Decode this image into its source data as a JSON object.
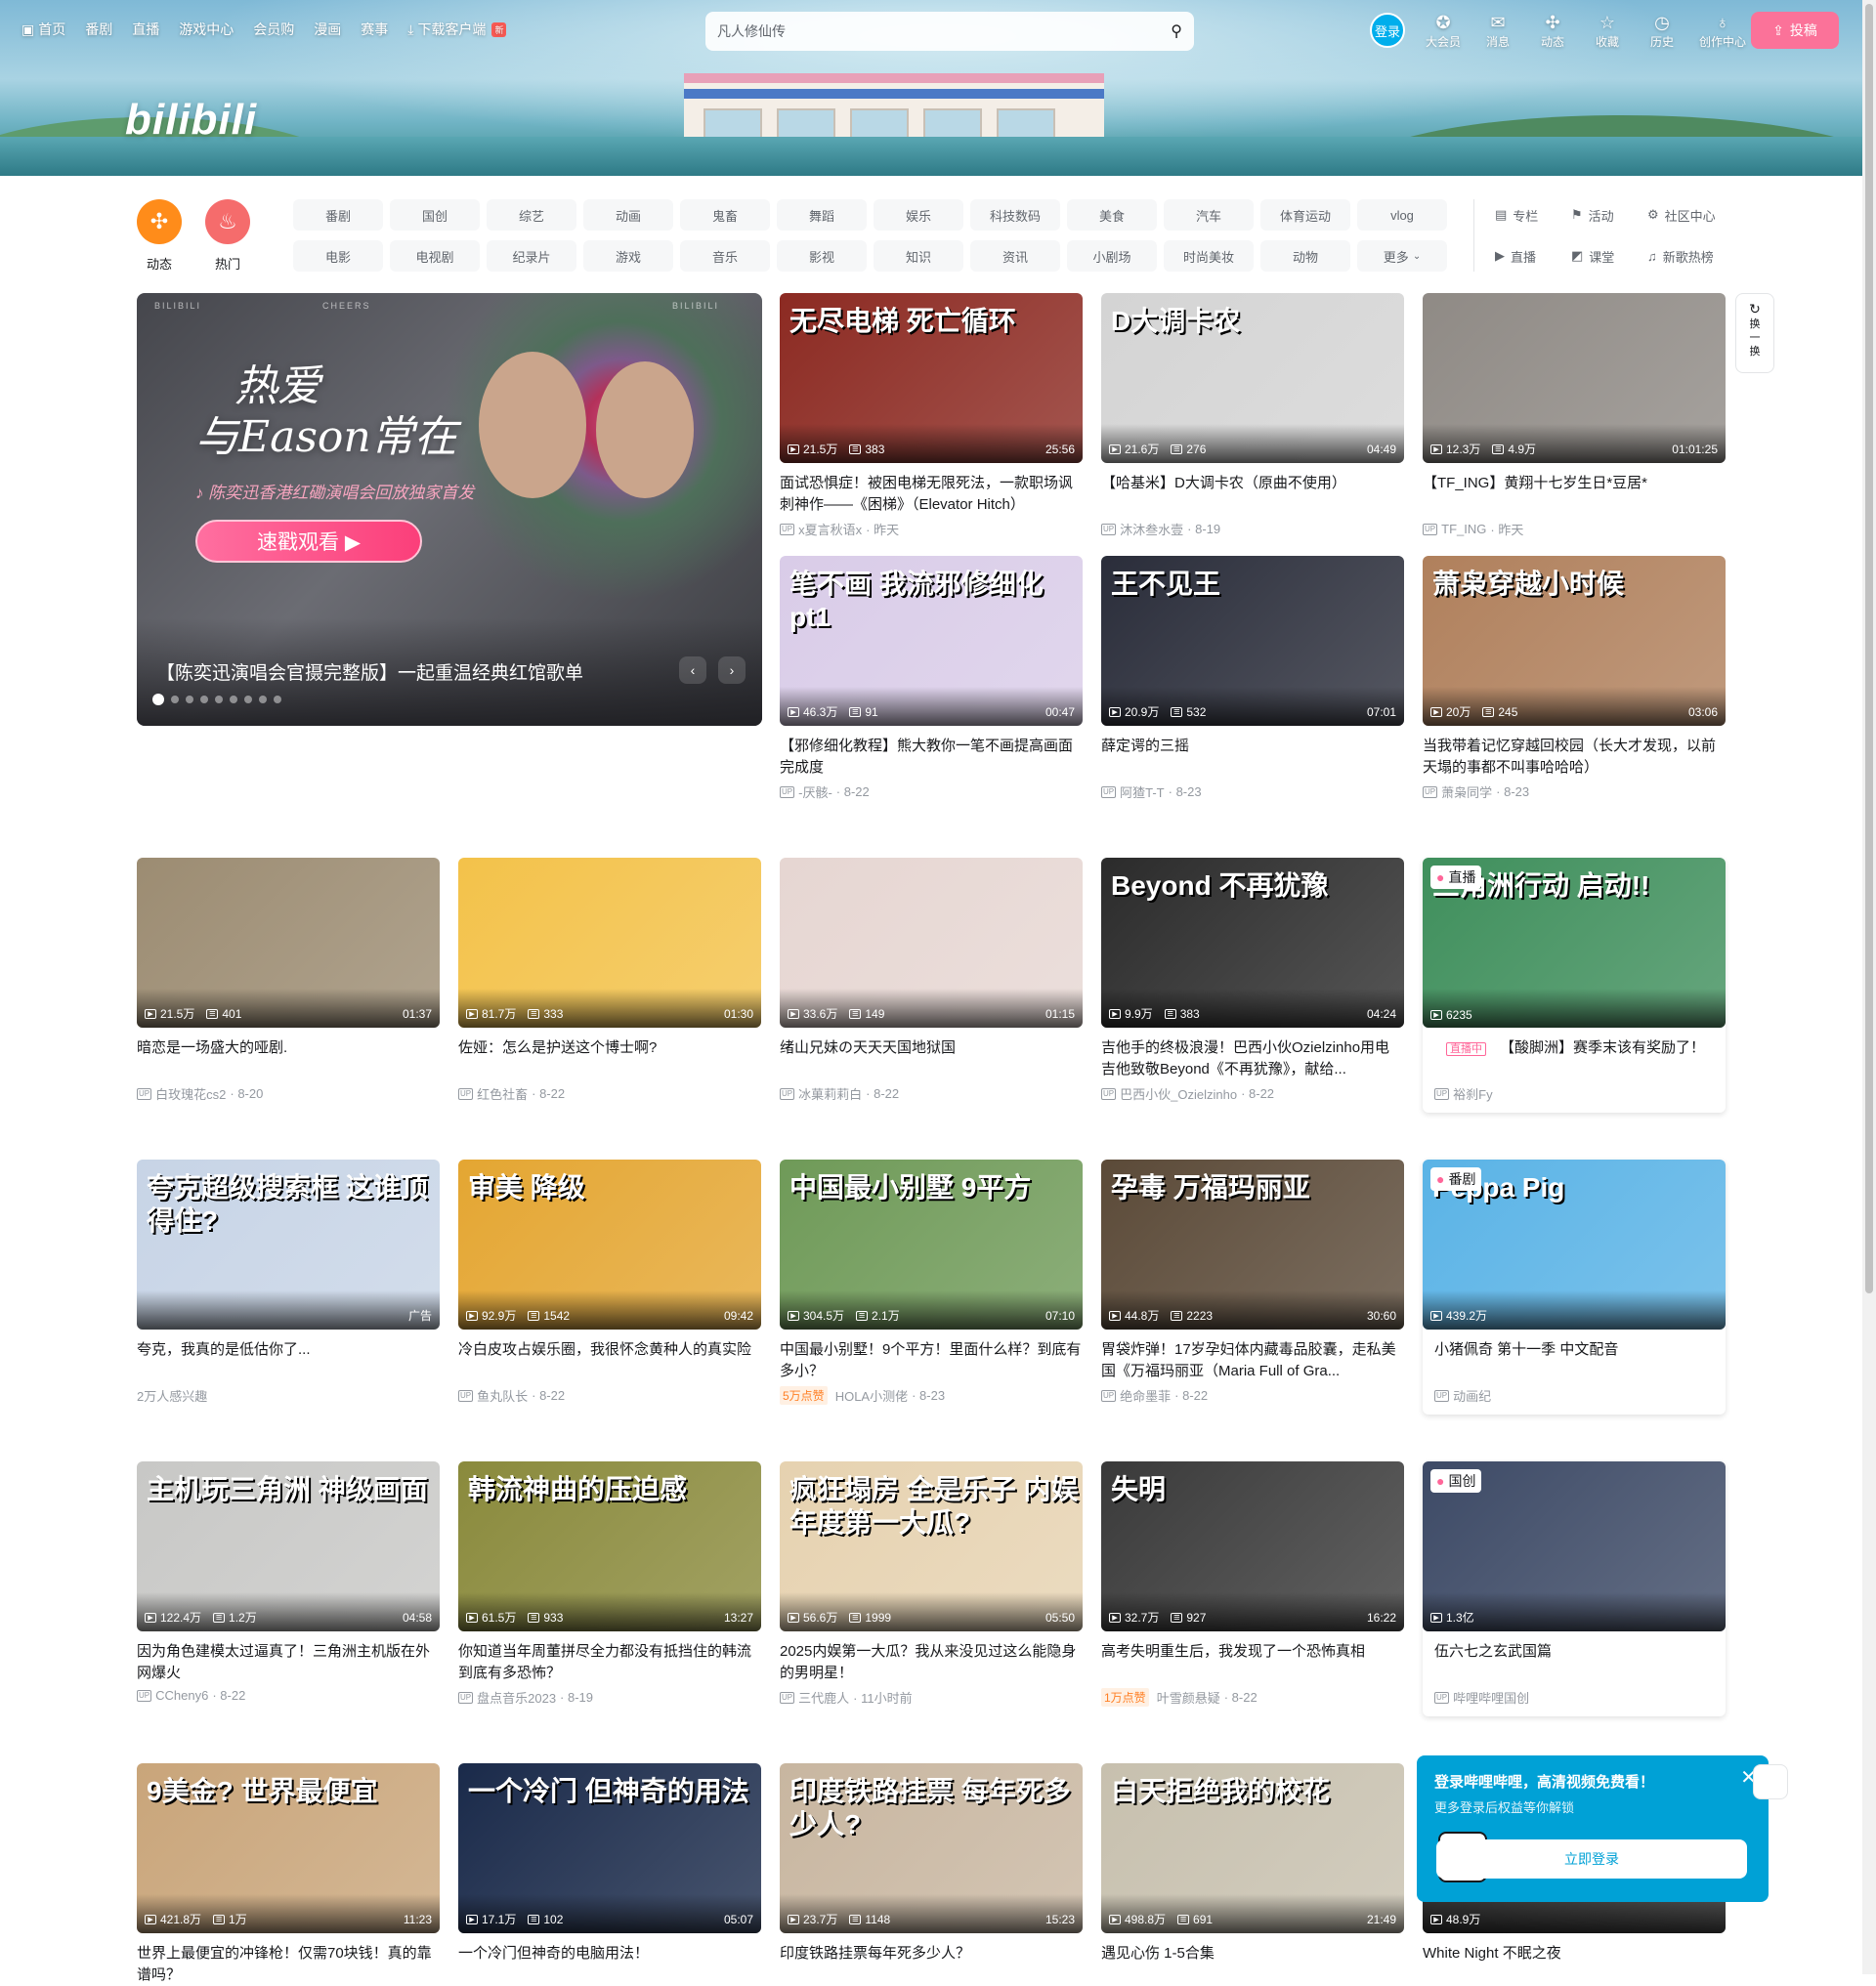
{
  "header": {
    "logo": "bilibili",
    "nav_left": [
      "首页",
      "番剧",
      "直播",
      "游戏中心",
      "会员购",
      "漫画",
      "赛事",
      "下载客户端"
    ],
    "new_badge": "新",
    "search_placeholder": "凡人修仙传",
    "login": "登录",
    "nav_right": [
      "大会员",
      "消息",
      "动态",
      "收藏",
      "历史",
      "创作中心"
    ],
    "upload": "投稿"
  },
  "channels": {
    "big": [
      "动态",
      "热门"
    ],
    "tags_row1": [
      "番剧",
      "国创",
      "综艺",
      "动画",
      "鬼畜",
      "舞蹈",
      "娱乐",
      "科技数码",
      "美食",
      "汽车",
      "体育运动",
      "vlog"
    ],
    "tags_row2": [
      "电影",
      "电视剧",
      "纪录片",
      "游戏",
      "音乐",
      "影视",
      "知识",
      "资讯",
      "小剧场",
      "时尚美妆",
      "动物",
      "更多"
    ],
    "extra": [
      "专栏",
      "活动",
      "社区中心",
      "直播",
      "课堂",
      "新歌热榜"
    ]
  },
  "banner": {
    "brand_left": "BILIBILI",
    "brand_mid": "CHEERS",
    "brand_right": "BILIBILI",
    "tagline_1": "热爱",
    "tagline_2": "与Eason常在",
    "subline": "陈奕迅香港红磡演唱会回放独家首发",
    "cta": "速戳观看 ▶",
    "title": "【陈奕迅演唱会官摄完整版】一起重温经典红馆歌单",
    "dots": 9
  },
  "refresh_label": "换一换",
  "colors": {
    "brand_pink": "#fb7299",
    "brand_blue": "#00aeec",
    "hot_orange": "#ff7f24"
  },
  "videos": [
    {
      "thumb_text": "无尽电梯 死亡循环",
      "views": "21.5万",
      "danmaku": "383",
      "dur": "25:56",
      "title": "面试恐惧症！被困电梯无限死法，一款职场讽刺神作——《困梯》（Elevator Hitch）",
      "up": "x夏言秋语x",
      "date": "昨天",
      "bg": "#8c2a22"
    },
    {
      "thumb_text": "D大调卡农",
      "views": "21.6万",
      "danmaku": "276",
      "dur": "04:49",
      "title": "【哈基米】D大调卡农（原曲不使用）",
      "up": "沐沐叁水壹",
      "date": "8-19",
      "bg": "#d4d4d4"
    },
    {
      "thumb_text": "",
      "views": "12.3万",
      "danmaku": "4.9万",
      "dur": "01:01:25",
      "title": "【TF_ING】黄翔十七岁生日*豆居*",
      "up": "TF_ING",
      "date": "昨天",
      "bg": "#8f8a85"
    },
    {
      "thumb_text": "笔不画 我流邪修细化pt1",
      "views": "46.3万",
      "danmaku": "91",
      "dur": "00:47",
      "title": "【邪修细化教程】熊大教你一笔不画提高画面完成度",
      "up": "-厌骸-",
      "date": "8-22",
      "bg": "#d9cce8"
    },
    {
      "thumb_text": "王不见王",
      "views": "20.9万",
      "danmaku": "532",
      "dur": "07:01",
      "title": "薛定谔的三摇",
      "up": "阿猹T-T",
      "date": "8-23",
      "bg": "#2a2d3a"
    },
    {
      "thumb_text": "萧枭穿越小时候",
      "views": "20万",
      "danmaku": "245",
      "dur": "03:06",
      "title": "当我带着记忆穿越回校园（长大才发现，以前天塌的事都不叫事哈哈哈）",
      "up": "萧枭同学",
      "date": "8-23",
      "bg": "#b0805c"
    },
    {
      "thumb_text": "",
      "views": "21.5万",
      "danmaku": "401",
      "dur": "01:37",
      "title": "暗恋是一场盛大的哑剧.",
      "up": "白玫瑰花cs2",
      "date": "8-20",
      "bg": "#9c8c72"
    },
    {
      "thumb_text": "",
      "views": "81.7万",
      "danmaku": "333",
      "dur": "01:30",
      "title": "佐娅：怎么是护送这个博士啊?",
      "up": "红色社畜",
      "date": "8-22",
      "bg": "#f3c24a"
    },
    {
      "thumb_text": "",
      "views": "33.6万",
      "danmaku": "149",
      "dur": "01:15",
      "title": "绪山兄妹の天天天国地狱国",
      "up": "冰菓莉莉白",
      "date": "8-22",
      "bg": "#e6d6d2"
    },
    {
      "thumb_text": "Beyond 不再犹豫",
      "views": "9.9万",
      "danmaku": "383",
      "dur": "04:24",
      "title": "吉他手的终极浪漫！巴西小伙Ozielzinho用电吉他致敬Beyond《不再犹豫》，献给...",
      "up": "巴西小伙_Ozielzinho",
      "date": "8-22",
      "bg": "#2b2b2b"
    },
    {
      "badge": "直播",
      "thumb_text": "三角洲行动 启动!!",
      "views": "6235",
      "title": "【酸脚洲】赛季末该有奖励了！",
      "live_tag": "直播中",
      "up": "裕刹Fy",
      "bg": "#3f8f5c"
    },
    {
      "thumb_text": "夸克超级搜索框 这谁顶得住?",
      "ad": "广告",
      "title": "夸克，我真的是低估你了...",
      "up": "2万人感兴趣",
      "bg": "#c7d4e6"
    },
    {
      "thumb_text": "审美 降级",
      "views": "92.9万",
      "danmaku": "1542",
      "dur": "09:42",
      "title": "冷白皮攻占娱乐圈，我很怀念黄种人的真实险",
      "up": "鱼丸队长",
      "date": "8-22",
      "bg": "#e4a632"
    },
    {
      "thumb_text": "中国最小别墅 9平方",
      "views": "304.5万",
      "danmaku": "2.1万",
      "dur": "07:10",
      "title": "中国最小别墅！9个平方！里面什么样？到底有多小？",
      "hot": "5万点赞",
      "up": "HOLA小测佬",
      "date": "8-23",
      "bg": "#6f9a58"
    },
    {
      "thumb_text": "孕毒 万福玛丽亚",
      "views": "44.8万",
      "danmaku": "2223",
      "dur": "30:60",
      "title": "胃袋炸弹！17岁孕妇体内藏毒品胶囊，走私美国《万福玛丽亚（Maria Full of Gra...",
      "up": "绝命墨菲",
      "date": "8-22",
      "bg": "#5b4a38"
    },
    {
      "badge": "番剧",
      "thumb_text": "Peppa Pig",
      "views": "439.2万",
      "title": "小猪佩奇 第十一季 中文配音",
      "up": "动画纪",
      "bg": "#5ab3e6"
    },
    {
      "thumb_text": "主机玩三角洲 神级画面",
      "views": "122.4万",
      "danmaku": "1.2万",
      "dur": "04:58",
      "title": "因为角色建模太过逼真了！三角洲主机版在外网爆火",
      "up": "CCheny6",
      "date": "8-22",
      "bg": "#c8c8c6"
    },
    {
      "thumb_text": "韩流神曲的压迫感",
      "views": "61.5万",
      "danmaku": "933",
      "dur": "13:27",
      "title": "你知道当年周董拼尽全力都没有抵挡住的韩流到底有多恐怖？",
      "up": "盘点音乐2023",
      "date": "8-19",
      "bg": "#8a8a3c"
    },
    {
      "thumb_text": "疯狂塌房 全是乐子 内娱年度第一大瓜?",
      "views": "56.6万",
      "danmaku": "1999",
      "dur": "05:50",
      "title": "2025内娱第一大瓜？我从来没见过这么能隐身的男明星！",
      "up": "三代鹿人",
      "date": "11小时前",
      "bg": "#e6d2b0"
    },
    {
      "thumb_text": "失明",
      "views": "32.7万",
      "danmaku": "927",
      "dur": "16:22",
      "title": "高考失明重生后，我发现了一个恐怖真相",
      "hot": "1万点赞",
      "up": "叶雪颜悬疑",
      "date": "8-22",
      "bg": "#3a3a3a"
    },
    {
      "badge": "国创",
      "thumb_text": "",
      "views": "1.3亿",
      "title": "伍六七之玄武国篇",
      "up": "哔哩哔哩国创",
      "bg": "#3d4a66"
    },
    {
      "thumb_text": "9美金? 世界最便宜",
      "views": "421.8万",
      "danmaku": "1万",
      "dur": "11:23",
      "title": "世界上最便宜的冲锋枪！仅需70块钱！真的靠谱吗？",
      "bg": "#c9a57a"
    },
    {
      "thumb_text": "一个冷门 但神奇的用法",
      "views": "17.1万",
      "danmaku": "102",
      "dur": "05:07",
      "title": "一个冷门但神奇的电脑用法！",
      "bg": "#1a2a4a"
    },
    {
      "thumb_text": "印度铁路挂票 每年死多少人?",
      "views": "23.7万",
      "danmaku": "1148",
      "dur": "15:23",
      "title": "印度铁路挂票每年死多少人？",
      "bg": "#c8b6a0"
    },
    {
      "thumb_text": "白天拒绝我的校花",
      "views": "498.8万",
      "danmaku": "691",
      "dur": "21:49",
      "title": "遇见心伤 1-5合集",
      "bg": "#c7c0ae"
    },
    {
      "thumb_text": "",
      "views": "48.9万",
      "title": "White Night 不眠之夜",
      "bg": "#2a2a2a"
    }
  ],
  "popup": {
    "title": "登录哔哩哔哩，高清视频免费看！",
    "desc": "更多登录后权益等你解锁",
    "button": "立即登录"
  }
}
